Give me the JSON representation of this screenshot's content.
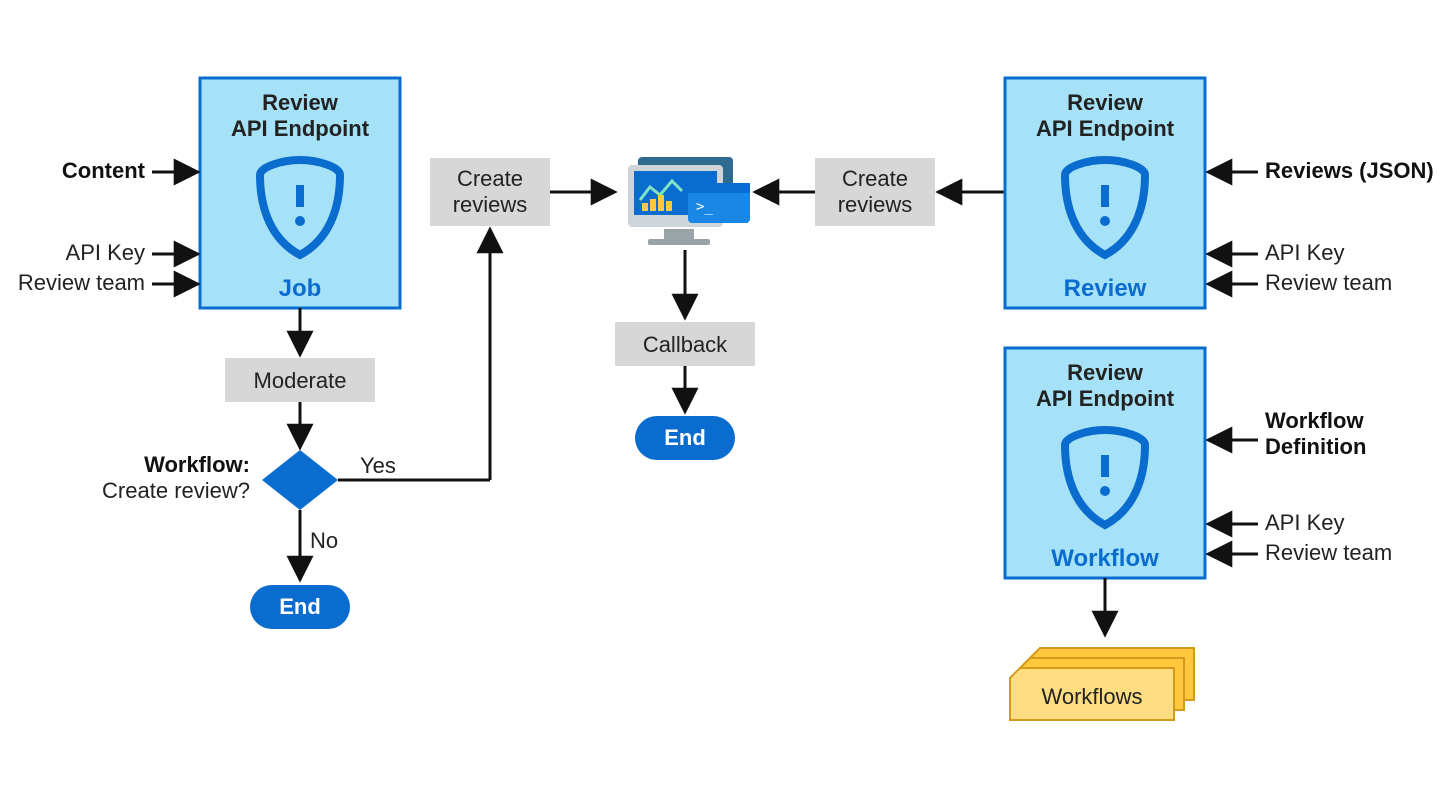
{
  "boxes": {
    "job": {
      "title1": "Review",
      "title2": "API Endpoint",
      "caption": "Job"
    },
    "review": {
      "title1": "Review",
      "title2": "API Endpoint",
      "caption": "Review"
    },
    "workflow": {
      "title1": "Review",
      "title2": "API Endpoint",
      "caption": "Workflow"
    }
  },
  "inputs": {
    "job": {
      "primary": "Content",
      "k1": "API Key",
      "k2": "Review team"
    },
    "review": {
      "primary": "Reviews (JSON)",
      "k1": "API Key",
      "k2": "Review team"
    },
    "workflow": {
      "primary": "Workflow",
      "primary2": "Definition",
      "k1": "API Key",
      "k2": "Review team"
    }
  },
  "steps": {
    "moderate": "Moderate",
    "createReviews": "Create\nreviews",
    "callback": "Callback",
    "end": "End",
    "workflowsStack": "Workflows"
  },
  "decision": {
    "title": "Workflow:",
    "subtitle": "Create review?",
    "yes": "Yes",
    "no": "No"
  }
}
